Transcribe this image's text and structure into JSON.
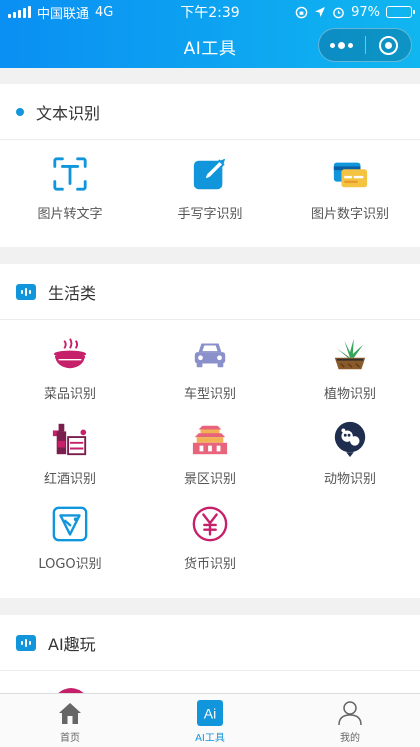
{
  "status_bar": {
    "carrier": "中国联通",
    "network": "4G",
    "time": "下午2:39",
    "battery": "97%",
    "battery_level": 0.97
  },
  "navbar": {
    "title": "AI工具"
  },
  "sections": {
    "text": {
      "title": "文本识别",
      "items": [
        {
          "label": "图片转文字",
          "icon": "text-scan-icon"
        },
        {
          "label": "手写字识别",
          "icon": "handwriting-pencil-icon"
        },
        {
          "label": "图片数字识别",
          "icon": "card-number-icon"
        }
      ]
    },
    "life": {
      "title": "生活类",
      "items": [
        {
          "label": "菜品识别",
          "icon": "dish-bowl-icon"
        },
        {
          "label": "车型识别",
          "icon": "car-icon"
        },
        {
          "label": "植物识别",
          "icon": "potted-plant-icon"
        },
        {
          "label": "红酒识别",
          "icon": "wine-bottle-icon"
        },
        {
          "label": "景区识别",
          "icon": "landmark-gate-icon"
        },
        {
          "label": "动物识别",
          "icon": "panda-icon"
        },
        {
          "label": "LOGO识别",
          "icon": "logo-triangle-icon"
        },
        {
          "label": "货币识别",
          "icon": "currency-yen-icon"
        }
      ]
    },
    "fun": {
      "title": "AI趣玩"
    }
  },
  "tabbar": {
    "items": [
      {
        "label": "首页",
        "icon": "home-icon"
      },
      {
        "label": "AI工具",
        "icon": "ai-tools-icon",
        "badge": "Ai"
      },
      {
        "label": "我的",
        "icon": "user-icon"
      }
    ],
    "active_color": "#1296db"
  },
  "colors": {
    "accent": "#1296db",
    "header_from": "#0a8ff2",
    "header_to": "#10b6f0"
  }
}
